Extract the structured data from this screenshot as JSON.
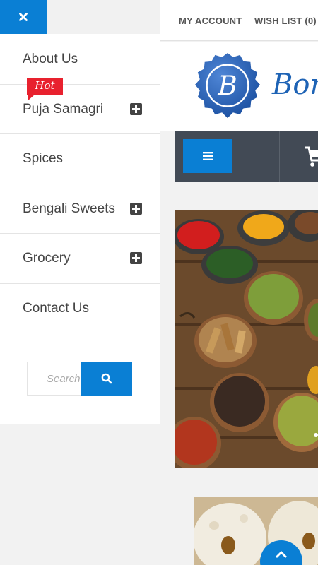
{
  "header": {
    "my_account": "MY ACCOUNT",
    "wish_list": "WISH LIST (0)"
  },
  "logo": {
    "letter": "B",
    "text": "Bon"
  },
  "drawer": {
    "badge": "Hot",
    "items": [
      {
        "label": "About Us",
        "expandable": false
      },
      {
        "label": "Puja Samagri",
        "expandable": true
      },
      {
        "label": "Spices",
        "expandable": false
      },
      {
        "label": "Bengali Sweets",
        "expandable": true
      },
      {
        "label": "Grocery",
        "expandable": true
      },
      {
        "label": "Contact Us",
        "expandable": false
      }
    ]
  },
  "search": {
    "placeholder": "Search"
  },
  "icons": {
    "close": "close-icon",
    "menu": "hamburger-icon",
    "cart": "cart-icon",
    "search": "search-icon",
    "expand": "plus-square-icon",
    "scroll_top": "chevron-up-icon"
  },
  "colors": {
    "accent": "#0a7fd4",
    "nav_bg": "#424a55",
    "hot_badge": "#e8212e",
    "logo_blue": "#1e63b5"
  }
}
